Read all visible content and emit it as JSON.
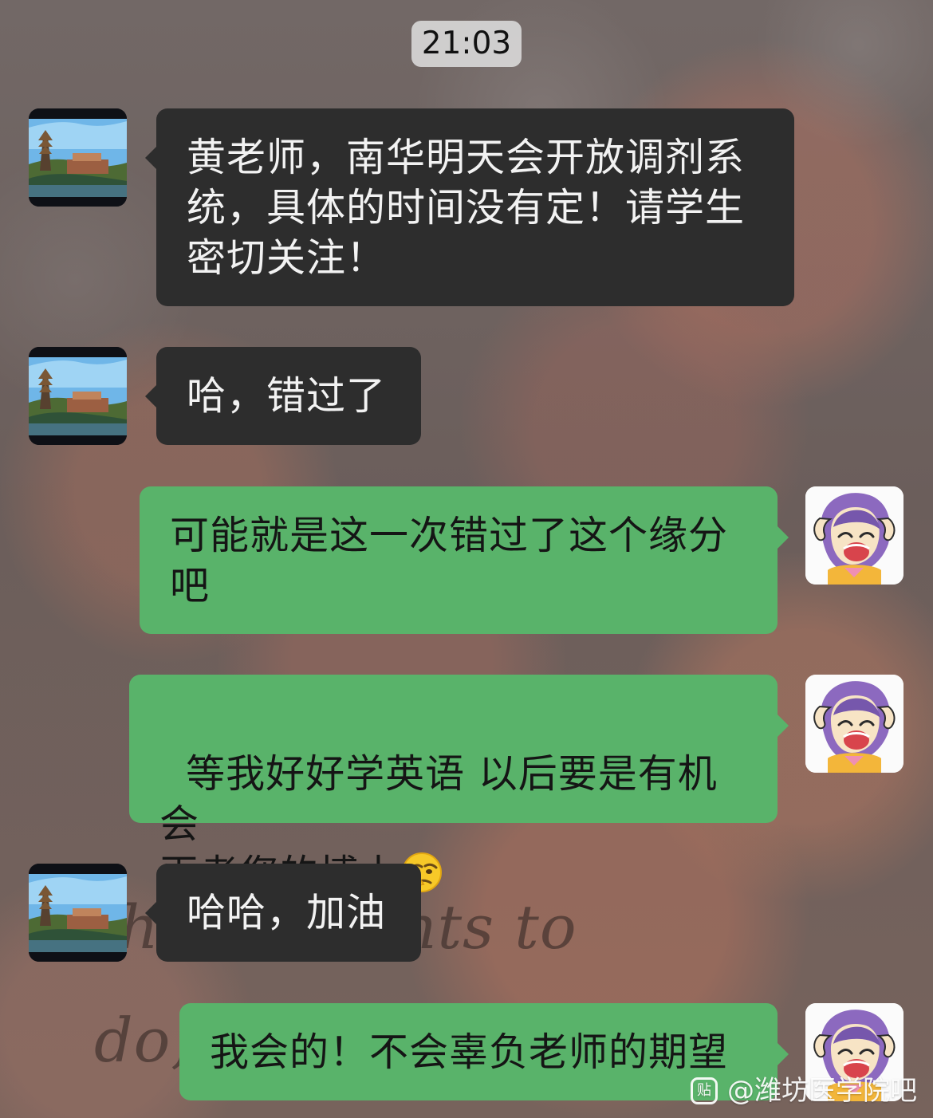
{
  "timestamp": "21:03",
  "messages": [
    {
      "side": "left",
      "text": "黄老师，南华明天会开放调剂系\n统，具体的时间没有定！请学生\n密切关注！"
    },
    {
      "side": "left",
      "text": "哈，错过了"
    },
    {
      "side": "right",
      "text": "可能就是这一次错过了这个缘分\n吧"
    },
    {
      "side": "right",
      "text_prefix": "等我好好学英语 以后要是有机会\n再考您的博士",
      "emoji": "thinking-face-icon"
    },
    {
      "side": "left",
      "text": "哈哈，加油"
    },
    {
      "side": "right",
      "text": "我会的！不会辜负老师的期望"
    }
  ],
  "background_script": {
    "line1": "heart wants to",
    "line2": "do,"
  },
  "watermark": {
    "logo": "贴",
    "text": "@潍坊医学院吧"
  },
  "colors": {
    "dark_bubble": "#2d2d2d",
    "green_bubble": "#59b36a",
    "time_pill": "#dcdcdc"
  }
}
